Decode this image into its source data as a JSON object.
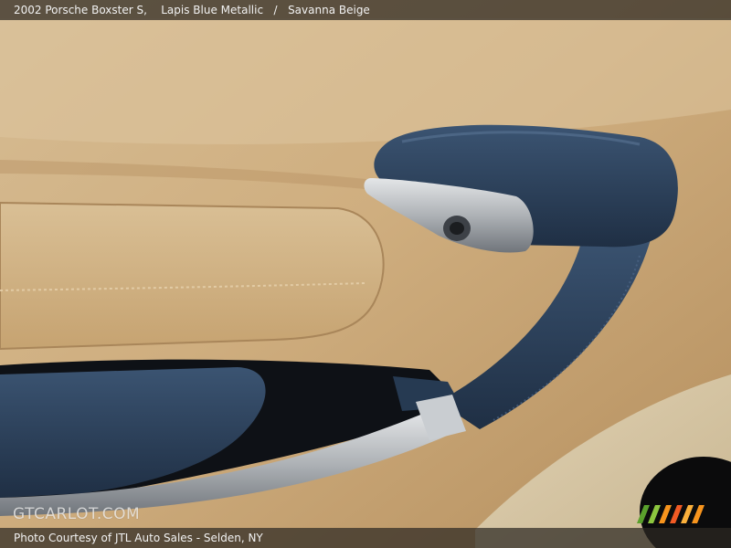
{
  "header": {
    "vehicle": "2002 Porsche Boxster S,",
    "exterior_color": "Lapis Blue Metallic",
    "separator": "/",
    "interior_color": "Savanna Beige"
  },
  "watermark": {
    "text": "GTCARLOT.COM"
  },
  "footer": {
    "credit": "Photo Courtesy of JTL Auto Sales - Selden, NY"
  },
  "colors": {
    "leather": "#c8a97c",
    "handle_blue": "#2b3f57",
    "chrome": "#b9bcc0",
    "logo_stripes": [
      "#5aa02c",
      "#8cc63f",
      "#f7941d",
      "#f15a24",
      "#fbb03b"
    ]
  },
  "icons": {
    "logo": "colored-slanted-stripes-logo"
  }
}
